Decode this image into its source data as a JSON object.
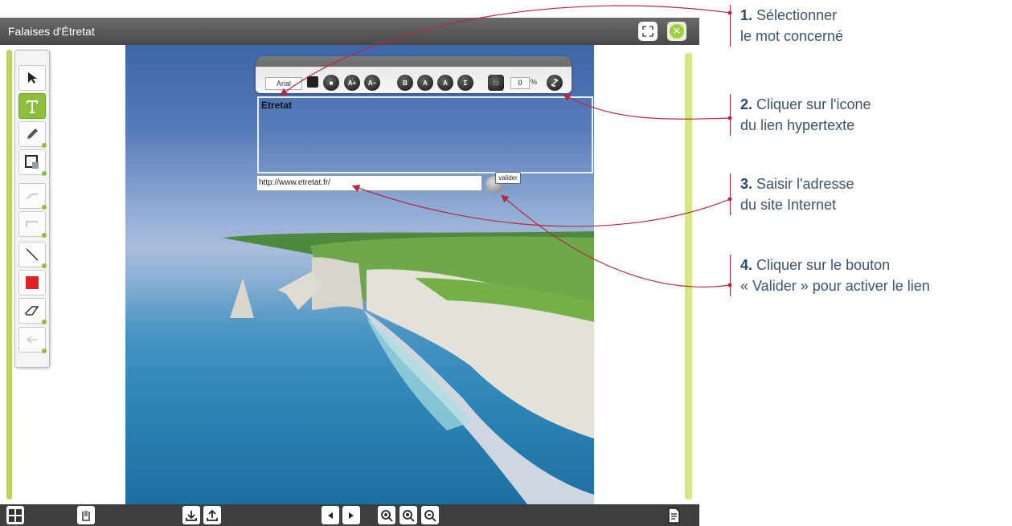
{
  "window": {
    "title": "Falaises d'Étretat"
  },
  "format_panel": {
    "font": "Arial",
    "buttons": [
      "A+",
      "A−",
      "B",
      "A",
      "A",
      "Σ"
    ],
    "opacity_value": "0",
    "opacity_unit": "%"
  },
  "text_box": {
    "content": "Etretat"
  },
  "link": {
    "url": "http://www.etretat.fr/",
    "validate_label": "valider"
  },
  "callouts": [
    {
      "number": "1.",
      "line1": "Sélectionner",
      "line2": "le mot concerné"
    },
    {
      "number": "2.",
      "line1": "Cliquer sur l'icone",
      "line2": "du lien hypertexte"
    },
    {
      "number": "3.",
      "line1": "Saisir l'adresse",
      "line2": "du site Internet"
    },
    {
      "number": "4.",
      "line1": "Cliquer sur le bouton",
      "line2": "« Valider » pour activer le lien"
    }
  ],
  "colors": {
    "accent_green": "#8cbf3c",
    "annotation_red": "#b32b3c",
    "callout_text": "#3b5470"
  }
}
